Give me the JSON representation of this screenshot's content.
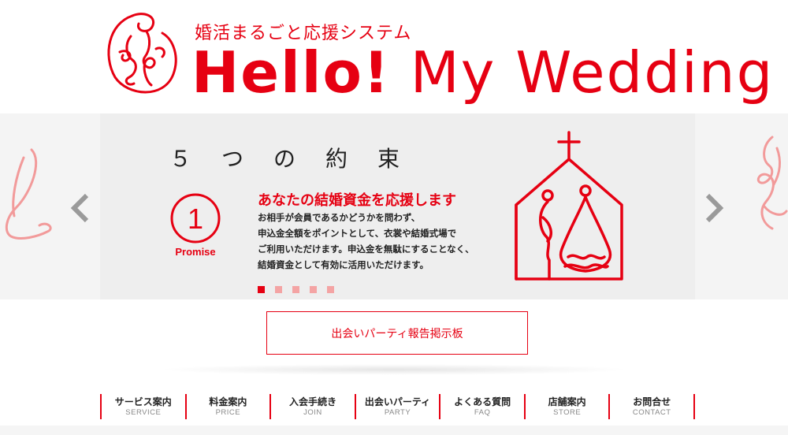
{
  "header": {
    "tagline": "婚活まるごと応援システム",
    "title_part1": "Hello!",
    "title_part2": " My Wedding"
  },
  "slider": {
    "heading": "５つの約束",
    "promise": {
      "number": "1",
      "label": "Promise",
      "title": "あなたの結婚資金を応援します",
      "body": [
        "お相手が会員であるかどうかを問わず、",
        "申込金全額をポイントとして、衣裳や結婚式場で",
        "ご利用いただけます。申込金を無駄にすることなく、",
        "結婚資金として有効に活用いただけます。"
      ]
    },
    "slide_count": 5,
    "active_index": 0
  },
  "report_button": {
    "label": "出会いパーティ報告掲示板"
  },
  "nav": {
    "items": [
      {
        "jp": "サービス案内",
        "en": "SERVICE"
      },
      {
        "jp": "料金案内",
        "en": "PRICE"
      },
      {
        "jp": "入会手続き",
        "en": "JOIN"
      },
      {
        "jp": "出会いパーティ",
        "en": "PARTY"
      },
      {
        "jp": "よくある質問",
        "en": "FAQ"
      },
      {
        "jp": "店舗案内",
        "en": "STORE"
      },
      {
        "jp": "お問合せ",
        "en": "CONTACT"
      }
    ]
  },
  "colors": {
    "brand_red": "#e60012",
    "inactive_dot": "#f4a4a4",
    "slider_bg": "#eeeeee"
  },
  "icons": {
    "logo": "couple-knot-logo-icon",
    "prev": "chevron-left-icon",
    "next": "chevron-right-icon",
    "illustration": "church-couple-icon"
  }
}
